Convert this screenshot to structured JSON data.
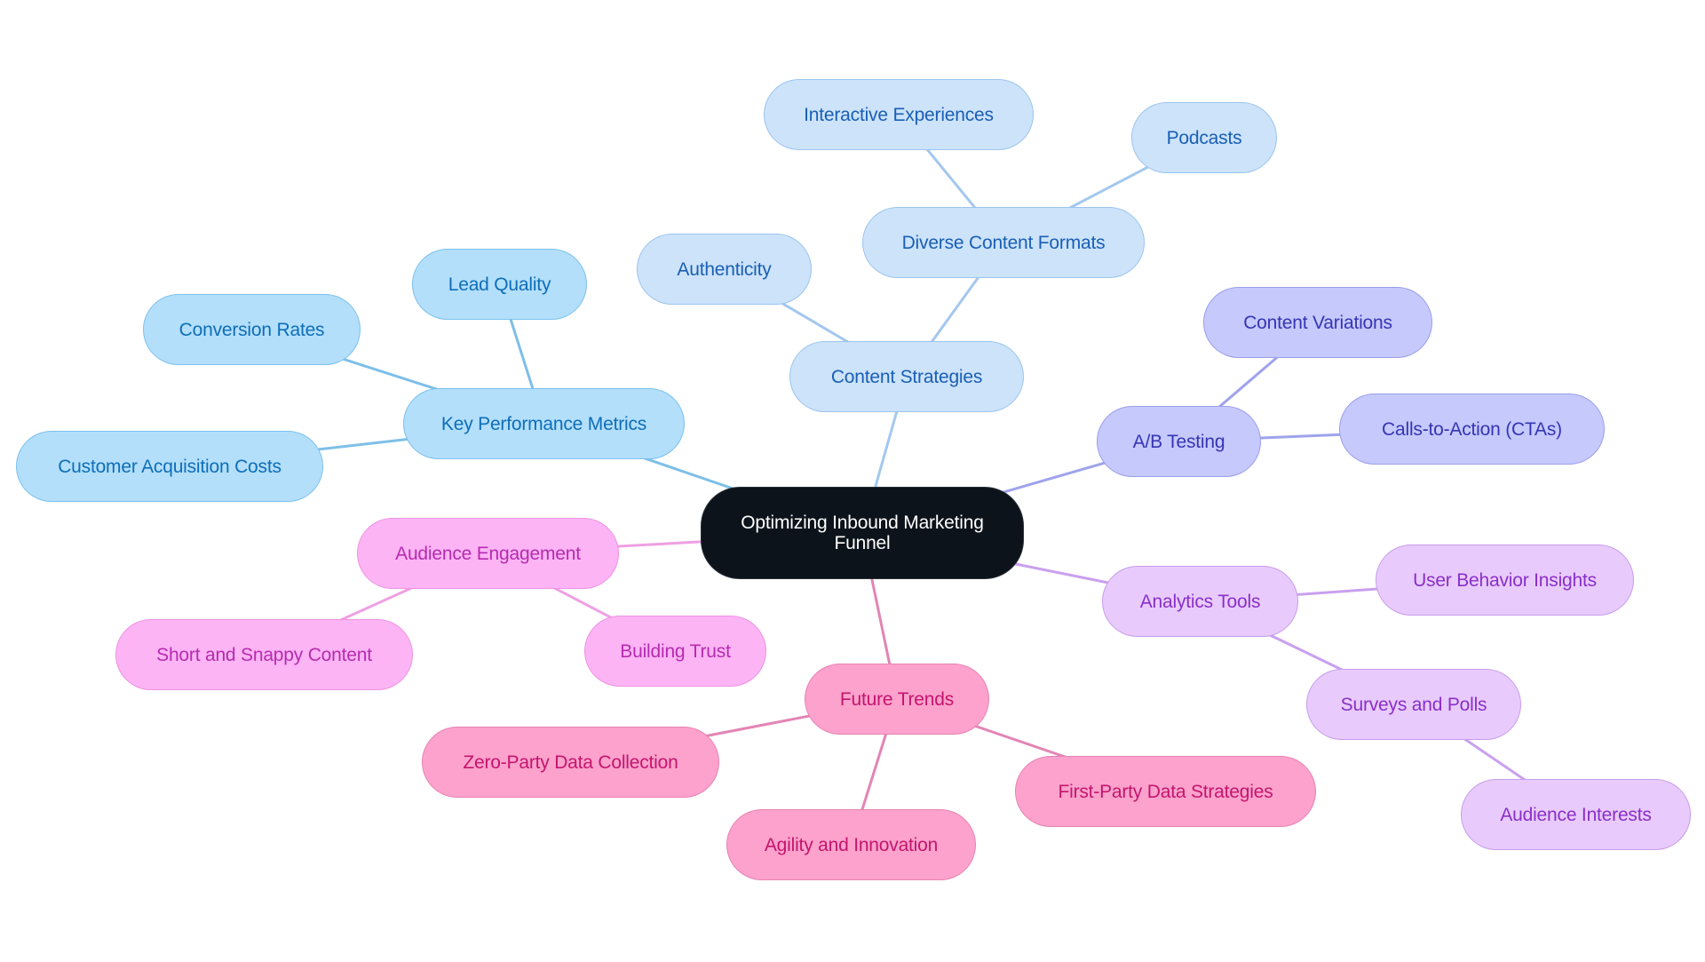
{
  "diagram": {
    "type": "mind-map",
    "root": {
      "id": "root",
      "label": "Optimizing Inbound Marketing Funnel",
      "group": "root"
    },
    "nodes": [
      {
        "id": "kpm",
        "label": "Key Performance Metrics",
        "group": "kpm",
        "parent": "root"
      },
      {
        "id": "lead_quality",
        "label": "Lead Quality",
        "group": "kpm",
        "parent": "kpm"
      },
      {
        "id": "conversion_rates",
        "label": "Conversion Rates",
        "group": "kpm",
        "parent": "kpm"
      },
      {
        "id": "cac",
        "label": "Customer Acquisition Costs",
        "group": "kpm",
        "parent": "kpm"
      },
      {
        "id": "content_strategies",
        "label": "Content Strategies",
        "group": "content",
        "parent": "root"
      },
      {
        "id": "authenticity",
        "label": "Authenticity",
        "group": "content",
        "parent": "content_strategies"
      },
      {
        "id": "diverse_formats",
        "label": "Diverse Content Formats",
        "group": "content",
        "parent": "content_strategies"
      },
      {
        "id": "interactive",
        "label": "Interactive Experiences",
        "group": "content",
        "parent": "diverse_formats"
      },
      {
        "id": "podcasts",
        "label": "Podcasts",
        "group": "content",
        "parent": "diverse_formats"
      },
      {
        "id": "ab_testing",
        "label": "A/B Testing",
        "group": "ab",
        "parent": "root"
      },
      {
        "id": "content_variations",
        "label": "Content Variations",
        "group": "ab",
        "parent": "ab_testing"
      },
      {
        "id": "ctas",
        "label": "Calls-to-Action (CTAs)",
        "group": "ab",
        "parent": "ab_testing"
      },
      {
        "id": "analytics",
        "label": "Analytics Tools",
        "group": "analyt",
        "parent": "root"
      },
      {
        "id": "ubi",
        "label": "User Behavior Insights",
        "group": "analyt",
        "parent": "analytics"
      },
      {
        "id": "surveys",
        "label": "Surveys and Polls",
        "group": "analyt",
        "parent": "analytics"
      },
      {
        "id": "aud_interests",
        "label": "Audience Interests",
        "group": "analyt",
        "parent": "surveys"
      },
      {
        "id": "aud_engagement",
        "label": "Audience Engagement",
        "group": "aud",
        "parent": "root"
      },
      {
        "id": "short_snappy",
        "label": "Short and Snappy Content",
        "group": "aud",
        "parent": "aud_engagement"
      },
      {
        "id": "building_trust",
        "label": "Building Trust",
        "group": "aud",
        "parent": "aud_engagement"
      },
      {
        "id": "future_trends",
        "label": "Future Trends",
        "group": "future",
        "parent": "root"
      },
      {
        "id": "zero_party",
        "label": "Zero-Party Data Collection",
        "group": "future",
        "parent": "future_trends"
      },
      {
        "id": "agility",
        "label": "Agility and Innovation",
        "group": "future",
        "parent": "future_trends"
      },
      {
        "id": "first_party",
        "label": "First-Party Data Strategies",
        "group": "future",
        "parent": "future_trends"
      }
    ],
    "group_colors": {
      "root": {
        "fill": "#0d131b",
        "text": "#ffffff",
        "edge": "#0d131b"
      },
      "kpm": {
        "fill": "#b3dffb",
        "text": "#0e6eb8",
        "edge": "#7dbfe8"
      },
      "content": {
        "fill": "#cce3fa",
        "text": "#1a5fb4",
        "edge": "#a3c8ee"
      },
      "ab": {
        "fill": "#c6c9fc",
        "text": "#3535b3",
        "edge": "#9fa3ec"
      },
      "analyt": {
        "fill": "#e8cbfc",
        "text": "#8a2fc9",
        "edge": "#c9a0ee"
      },
      "aud": {
        "fill": "#fcb4f4",
        "text": "#b62bb0",
        "edge": "#eea0e3"
      },
      "future": {
        "fill": "#fca2cc",
        "text": "#c4156e",
        "edge": "#e385b5"
      }
    }
  }
}
